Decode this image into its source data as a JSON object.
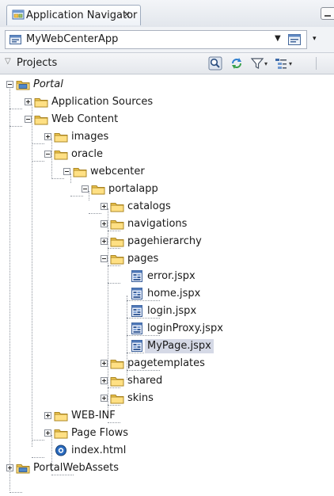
{
  "tab": {
    "title": "Application Navigator",
    "close": "×"
  },
  "app": {
    "name": "MyWebCenterApp",
    "caret": "▼",
    "menu_caret": "▾"
  },
  "projects": {
    "label": "Projects",
    "caret": "▽"
  },
  "toolbar": {
    "filter_caret": "▾",
    "options_caret": "▾"
  },
  "tree": [
    {
      "label": "Portal",
      "icon": "project-icon",
      "expander": "minus",
      "italic": true
    },
    {
      "label": "Application Sources",
      "icon": "folder-icon",
      "expander": "plus"
    },
    {
      "label": "Web Content",
      "icon": "folder-icon",
      "expander": "minus"
    },
    {
      "label": "images",
      "icon": "folder-icon",
      "expander": "plus"
    },
    {
      "label": "oracle",
      "icon": "folder-icon",
      "expander": "minus"
    },
    {
      "label": "webcenter",
      "icon": "folder-icon",
      "expander": "minus"
    },
    {
      "label": "portalapp",
      "icon": "folder-icon",
      "expander": "minus"
    },
    {
      "label": "catalogs",
      "icon": "folder-icon",
      "expander": "plus"
    },
    {
      "label": "navigations",
      "icon": "folder-icon",
      "expander": "plus"
    },
    {
      "label": "pagehierarchy",
      "icon": "folder-icon",
      "expander": "plus"
    },
    {
      "label": "pages",
      "icon": "folder-icon",
      "expander": "minus"
    },
    {
      "label": "error.jspx",
      "icon": "jspx-file-icon"
    },
    {
      "label": "home.jspx",
      "icon": "jspx-file-icon"
    },
    {
      "label": "login.jspx",
      "icon": "jspx-file-icon"
    },
    {
      "label": "loginProxy.jspx",
      "icon": "jspx-file-icon"
    },
    {
      "label": "MyPage.jspx",
      "icon": "jspx-file-icon",
      "selected": true
    },
    {
      "label": "pagetemplates",
      "icon": "folder-icon",
      "expander": "plus"
    },
    {
      "label": "shared",
      "icon": "folder-icon",
      "expander": "plus"
    },
    {
      "label": "skins",
      "icon": "folder-icon",
      "expander": "plus"
    },
    {
      "label": "WEB-INF",
      "icon": "folder-icon",
      "expander": "plus"
    },
    {
      "label": "Page Flows",
      "icon": "folder-icon",
      "expander": "plus"
    },
    {
      "label": "index.html",
      "icon": "html-file-icon"
    },
    {
      "label": "PortalWebAssets",
      "icon": "project-icon",
      "expander": "plus"
    }
  ]
}
